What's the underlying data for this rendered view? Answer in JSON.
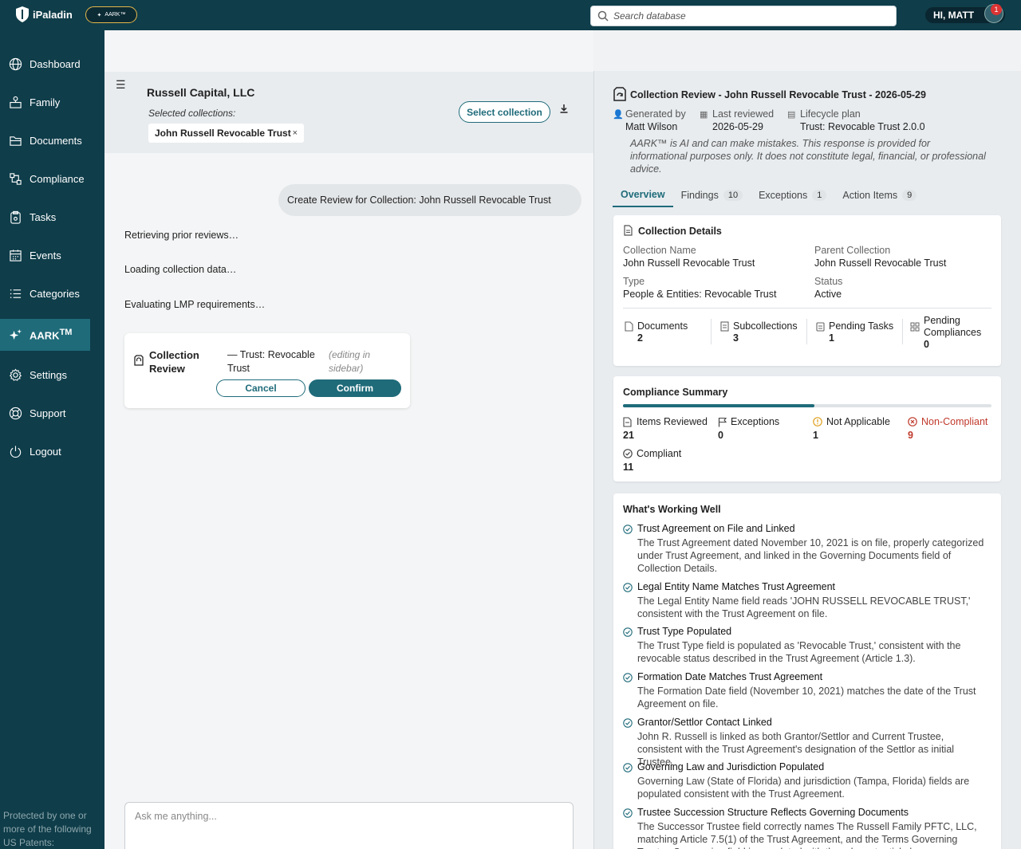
{
  "topbar": {
    "logo_text": "iPaladin",
    "aark_label": "AARK™",
    "search_placeholder": "Search database",
    "user_greeting": "HI, MATT",
    "notification_count": "1"
  },
  "sidebar": {
    "items": [
      {
        "label": "Dashboard",
        "icon": "globe-icon"
      },
      {
        "label": "Family",
        "icon": "family-icon"
      },
      {
        "label": "Documents",
        "icon": "folder-icon"
      },
      {
        "label": "Compliance",
        "icon": "compliance-icon"
      },
      {
        "label": "Tasks",
        "icon": "clipboard-icon"
      },
      {
        "label": "Events",
        "icon": "calendar-icon"
      },
      {
        "label": "Categories",
        "icon": "list-icon"
      },
      {
        "label": "AARK",
        "sup": "TM",
        "icon": "sparkle-icon",
        "active": true
      },
      {
        "label": "Settings",
        "icon": "gear-icon"
      },
      {
        "label": "Support",
        "icon": "lifebuoy-icon"
      },
      {
        "label": "Logout",
        "icon": "power-icon"
      }
    ],
    "patent_text": "Protected by one or more of the following US Patents:"
  },
  "main": {
    "org_name": "Russell Capital, LLC",
    "selected_label": "Selected collections:",
    "chip_label": "John Russell Revocable Trust",
    "chip_close": "×",
    "select_button": "Select collection",
    "user_message": "Create Review for Collection: John Russell Revocable Trust",
    "status_lines": [
      "Retrieving prior reviews…",
      "Loading collection data…",
      "Evaluating LMP requirements…"
    ],
    "review_card": {
      "title": "Collection Review",
      "type": "— Trust: Revocable Trust",
      "editing": "(editing in sidebar)",
      "cancel": "Cancel",
      "confirm": "Confirm"
    },
    "ask_placeholder": "Ask me anything..."
  },
  "panel": {
    "title": "Collection Review - John Russell Revocable Trust - 2026-05-29",
    "generated_by_label": "Generated by",
    "generated_by_value": "Matt Wilson",
    "last_reviewed_label": "Last reviewed",
    "last_reviewed_value": "2026-05-29",
    "lifecycle_label": "Lifecycle plan",
    "lifecycle_value": "Trust: Revocable Trust 2.0.0",
    "disclaimer": "AARK™ is AI and can make mistakes. This response is provided for informational purposes only. It does not constitute legal, financial, or professional advice.",
    "tabs": [
      {
        "label": "Overview",
        "count": ""
      },
      {
        "label": "Findings",
        "count": "10"
      },
      {
        "label": "Exceptions",
        "count": "1"
      },
      {
        "label": "Action Items",
        "count": "9"
      }
    ],
    "details": {
      "title": "Collection Details",
      "name_label": "Collection Name",
      "name_value": "John Russell Revocable Trust",
      "parent_label": "Parent Collection",
      "parent_value": "John Russell Revocable Trust",
      "type_label": "Type",
      "type_value": "People & Entities: Revocable Trust",
      "status_label": "Status",
      "status_value": "Active",
      "stats": [
        {
          "label": "Documents",
          "value": "2"
        },
        {
          "label": "Subcollections",
          "value": "3"
        },
        {
          "label": "Pending Tasks",
          "value": "1"
        },
        {
          "label": "Pending Compliances",
          "value": "0"
        }
      ]
    },
    "summary": {
      "title": "Compliance Summary",
      "progress_fraction": 0.52,
      "items": [
        {
          "label": "Items Reviewed",
          "value": "21"
        },
        {
          "label": "Exceptions",
          "value": "0"
        },
        {
          "label": "Not Applicable",
          "value": "1"
        },
        {
          "label": "Non-Compliant",
          "value": "9"
        },
        {
          "label": "Compliant",
          "value": "11"
        }
      ],
      "noncompliant_color": "#c0392b",
      "na_color": "#e0a020"
    },
    "working_well": {
      "title": "What's Working Well",
      "items": [
        {
          "title": "Trust Agreement on File and Linked",
          "desc": "The Trust Agreement dated November 10, 2021 is on file, properly categorized under Trust Agreement, and linked in the Governing Documents field of Collection Details."
        },
        {
          "title": "Legal Entity Name Matches Trust Agreement",
          "desc": "The Legal Entity Name field reads 'JOHN RUSSELL REVOCABLE TRUST,' consistent with the Trust Agreement on file."
        },
        {
          "title": "Trust Type Populated",
          "desc": "The Trust Type field is populated as 'Revocable Trust,' consistent with the revocable status described in the Trust Agreement (Article 1.3)."
        },
        {
          "title": "Formation Date Matches Trust Agreement",
          "desc": "The Formation Date field (November 10, 2021) matches the date of the Trust Agreement on file."
        },
        {
          "title": "Grantor/Settlor Contact Linked",
          "desc": "John R. Russell is linked as both Grantor/Settlor and Current Trustee, consistent with the Trust Agreement's designation of the Settlor as initial Trustee."
        },
        {
          "title": "Governing Law and Jurisdiction Populated",
          "desc": "Governing Law (State of Florida) and jurisdiction (Tampa, Florida) fields are populated consistent with the Trust Agreement."
        },
        {
          "title": "Trustee Succession Structure Reflects Governing Documents",
          "desc": "The Successor Trustee field correctly names The Russell Family PFTC, LLC, matching Article 7.5(1) of the Trust Agreement, and the Terms Governing Trustee Succession field is populated with the relevant article language."
        }
      ]
    }
  }
}
